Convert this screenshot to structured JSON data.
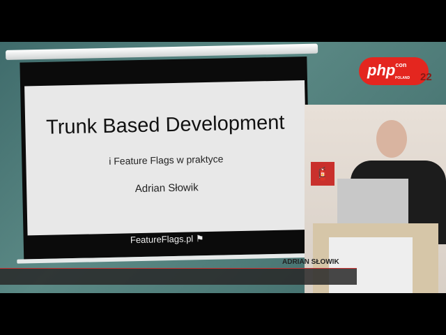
{
  "slide": {
    "title": "Trunk Based Development",
    "subtitle": "i Feature Flags w praktyce",
    "author": "Adrian Słowik",
    "footer": "FeatureFlags.pl"
  },
  "logo": {
    "main": "php",
    "sup": "con",
    "country": "POLAND",
    "year": "22"
  },
  "lower_third": {
    "name": "ADRIAN SŁOWIK"
  },
  "icons": {
    "footer": "flag-icon",
    "sign": "fire-extinguisher-icon"
  }
}
